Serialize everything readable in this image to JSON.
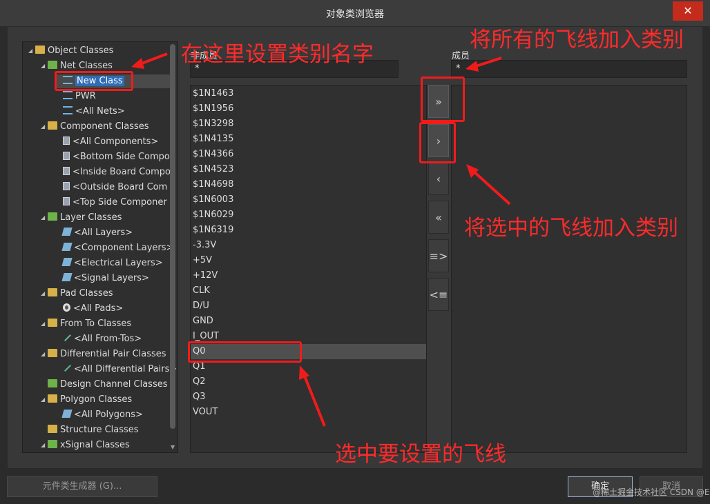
{
  "window": {
    "title": "对象类浏览器",
    "close_glyph": "✕"
  },
  "tree": {
    "root": "Object Classes",
    "items": [
      {
        "label": "Net Classes",
        "icon": "folder-icon",
        "level": 1,
        "arrow": "◢"
      },
      {
        "label": "New Class",
        "icon": "net-icon",
        "level": 2,
        "selected": true
      },
      {
        "label": "PWR",
        "icon": "net-icon",
        "level": 2
      },
      {
        "label": "<All Nets>",
        "icon": "net-icon",
        "level": 2
      },
      {
        "label": "Component Classes",
        "icon": "folder-icon",
        "level": 1,
        "arrow": "◢"
      },
      {
        "label": "<All Components>",
        "icon": "component-icon",
        "level": 2
      },
      {
        "label": "<Bottom Side Compo",
        "icon": "component-icon",
        "level": 2
      },
      {
        "label": "<Inside Board Compo",
        "icon": "component-icon",
        "level": 2
      },
      {
        "label": "<Outside Board Com",
        "icon": "component-icon",
        "level": 2
      },
      {
        "label": "<Top Side Componer",
        "icon": "component-icon",
        "level": 2
      },
      {
        "label": "Layer Classes",
        "icon": "folder-icon",
        "level": 1,
        "arrow": "◢"
      },
      {
        "label": "<All Layers>",
        "icon": "layer-icon",
        "level": 2
      },
      {
        "label": "<Component Layers>",
        "icon": "layer-icon",
        "level": 2
      },
      {
        "label": "<Electrical Layers>",
        "icon": "layer-icon",
        "level": 2
      },
      {
        "label": "<Signal Layers>",
        "icon": "layer-icon",
        "level": 2
      },
      {
        "label": "Pad Classes",
        "icon": "folder-icon",
        "level": 1,
        "arrow": "◢"
      },
      {
        "label": "<All Pads>",
        "icon": "pad-icon",
        "level": 2
      },
      {
        "label": "From To Classes",
        "icon": "folder-icon",
        "level": 1,
        "arrow": "◢"
      },
      {
        "label": "<All From-Tos>",
        "icon": "fromto-icon",
        "level": 2
      },
      {
        "label": "Differential Pair Classes",
        "icon": "folder-icon",
        "level": 1,
        "arrow": "◢"
      },
      {
        "label": "<All Differential Pairs>",
        "icon": "fromto-icon",
        "level": 2
      },
      {
        "label": "Design Channel Classes",
        "icon": "folder-icon",
        "level": 1,
        "arrow": ""
      },
      {
        "label": "Polygon Classes",
        "icon": "folder-icon",
        "level": 1,
        "arrow": "◢"
      },
      {
        "label": "<All Polygons>",
        "icon": "layer-icon",
        "level": 2
      },
      {
        "label": "Structure Classes",
        "icon": "folder-icon",
        "level": 1,
        "arrow": ""
      },
      {
        "label": "xSignal Classes",
        "icon": "folder-icon",
        "level": 1,
        "arrow": "◢"
      }
    ]
  },
  "non_members": {
    "header": "非成员",
    "filter": "*",
    "items": [
      "$1N1463",
      "$1N1956",
      "$1N3298",
      "$1N4135",
      "$1N4366",
      "$1N4523",
      "$1N4698",
      "$1N6003",
      "$1N6029",
      "$1N6319",
      "-3.3V",
      "+5V",
      "+12V",
      "CLK",
      "D/U",
      "GND",
      "I_OUT",
      "Q0",
      "Q1",
      "Q2",
      "Q3",
      "VOUT"
    ],
    "selected": "Q0"
  },
  "members": {
    "header": "成员",
    "filter": "*",
    "items": []
  },
  "transfer_buttons": [
    {
      "name": "add-all-button",
      "glyph": "»"
    },
    {
      "name": "add-selected-button",
      "glyph": "›"
    },
    {
      "name": "remove-selected-button",
      "glyph": "‹"
    },
    {
      "name": "remove-all-button",
      "glyph": "«"
    },
    {
      "name": "add-expression-button",
      "glyph": "≡>"
    },
    {
      "name": "remove-expression-button",
      "glyph": "<≡"
    }
  ],
  "footer": {
    "generator_label": "元件类生成器 (G)...",
    "ok_label": "确定",
    "cancel_label": "取消"
  },
  "annotations": {
    "set_name": "在这里设置类别名字",
    "add_all": "将所有的飞线加入类别",
    "add_selected": "将选中的飞线加入类别",
    "select_nets": "选中要设置的飞线",
    "color": "#f21b1b"
  },
  "watermark": "@稀土掘金技术社区 CSDN @EDA小白"
}
